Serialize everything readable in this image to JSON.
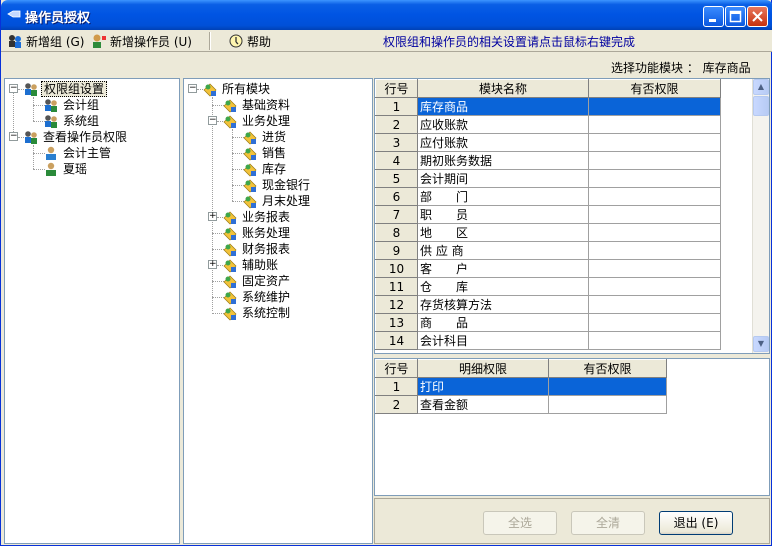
{
  "window": {
    "title": "操作员授权"
  },
  "toolbar": {
    "new_group": "新增组 (G)",
    "new_operator": "新增操作员 (U)",
    "help": "帮助",
    "hint": "权限组和操作员的相关设置请点击鼠标右键完成"
  },
  "module_select": {
    "label": "选择功能模块 ：",
    "value": "库存商品"
  },
  "left_tree": [
    {
      "label": "权限组设置",
      "icon": "group-icon",
      "selected": true
    },
    {
      "label": "会计组",
      "icon": "group-icon"
    },
    {
      "label": "系统组",
      "icon": "group-icon"
    },
    {
      "label": "查看操作员权限",
      "icon": "group-icon"
    },
    {
      "label": "会计主管",
      "icon": "user-icon"
    },
    {
      "label": "夏瑶",
      "icon": "user-icon"
    }
  ],
  "module_tree": [
    {
      "label": "所有模块"
    },
    {
      "label": "基础资料"
    },
    {
      "label": "业务处理"
    },
    {
      "label": "进货"
    },
    {
      "label": "销售"
    },
    {
      "label": "库存"
    },
    {
      "label": "现金银行"
    },
    {
      "label": "月末处理"
    },
    {
      "label": "业务报表"
    },
    {
      "label": "账务处理"
    },
    {
      "label": "财务报表"
    },
    {
      "label": "辅助账"
    },
    {
      "label": "固定资产"
    },
    {
      "label": "系统维护"
    },
    {
      "label": "系统控制"
    }
  ],
  "module_table": {
    "headers": [
      "行号",
      "模块名称",
      "有否权限"
    ],
    "rows": [
      {
        "no": "1",
        "name": "库存商品",
        "perm": ""
      },
      {
        "no": "2",
        "name": "应收账款",
        "perm": ""
      },
      {
        "no": "3",
        "name": "应付账款",
        "perm": ""
      },
      {
        "no": "4",
        "name": "期初账务数据",
        "perm": ""
      },
      {
        "no": "5",
        "name": "会计期间",
        "perm": ""
      },
      {
        "no": "6",
        "name": "部　　门",
        "perm": ""
      },
      {
        "no": "7",
        "name": "职　　员",
        "perm": ""
      },
      {
        "no": "8",
        "name": "地　　区",
        "perm": ""
      },
      {
        "no": "9",
        "name": "供 应 商",
        "perm": ""
      },
      {
        "no": "10",
        "name": "客　　户",
        "perm": ""
      },
      {
        "no": "11",
        "name": "仓　　库",
        "perm": ""
      },
      {
        "no": "12",
        "name": "存货核算方法",
        "perm": ""
      },
      {
        "no": "13",
        "name": "商　　品",
        "perm": ""
      },
      {
        "no": "14",
        "name": "会计科目",
        "perm": ""
      }
    ]
  },
  "detail_table": {
    "headers": [
      "行号",
      "明细权限",
      "有否权限"
    ],
    "rows": [
      {
        "no": "1",
        "name": "打印",
        "perm": ""
      },
      {
        "no": "2",
        "name": "查看金额",
        "perm": ""
      }
    ]
  },
  "buttons": {
    "select_all": "全选",
    "clear_all": "全清",
    "exit": "退出 (E)"
  }
}
